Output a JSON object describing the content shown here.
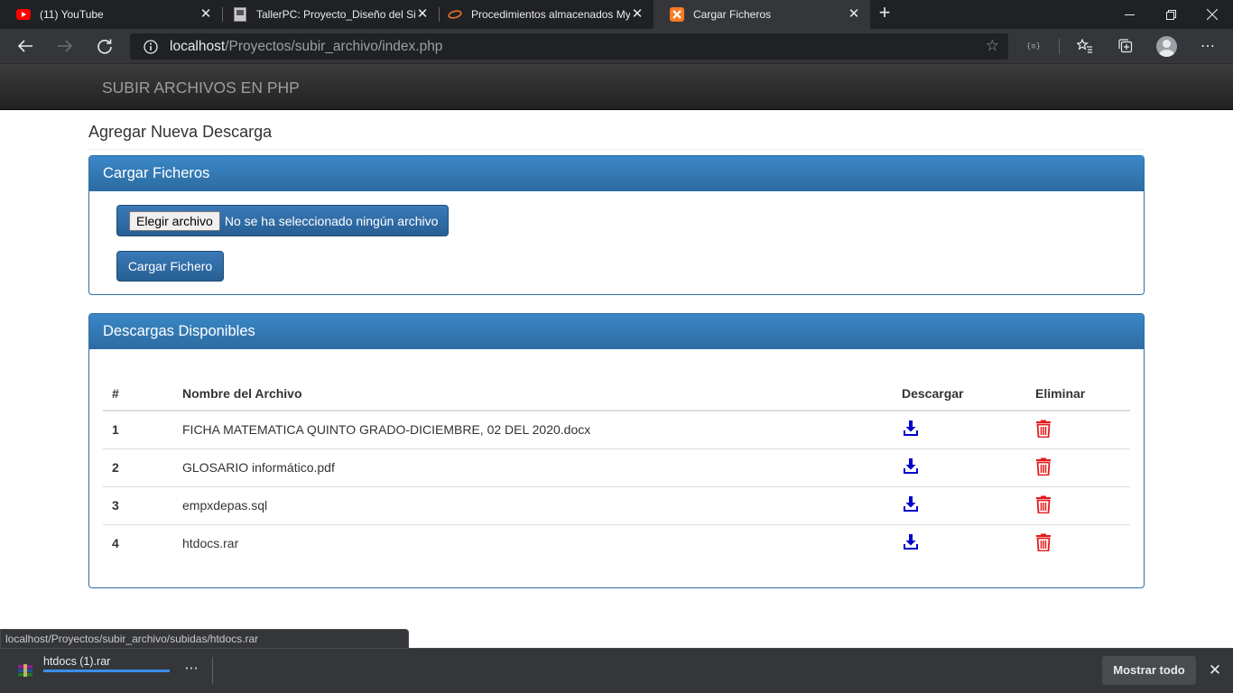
{
  "browser": {
    "tabs": [
      {
        "title": "(11) YouTube",
        "icon": "youtube-icon"
      },
      {
        "title": "TallerPC: Proyecto_Diseño del Sis",
        "icon": "page-icon"
      },
      {
        "title": "Procedimientos almacenados My",
        "icon": "link-icon"
      },
      {
        "title": "Cargar Ficheros",
        "icon": "xampp-icon"
      }
    ],
    "new_tab": "+",
    "url_host": "localhost",
    "url_path": "/Proyectos/subir_archivo/index.php",
    "close_glyph": "✕",
    "more_glyph": "⋯"
  },
  "navbar": {
    "brand": "SUBIR ARCHIVOS EN PHP"
  },
  "page": {
    "title": "Agregar Nueva Descarga"
  },
  "upload_panel": {
    "heading": "Cargar Ficheros",
    "choose_button": "Elegir archivo",
    "no_file_text": "No se ha seleccionado ningún archivo",
    "submit_button": "Cargar Fichero"
  },
  "downloads_panel": {
    "heading": "Descargas Disponibles",
    "columns": [
      "#",
      "Nombre del Archivo",
      "Descargar",
      "Eliminar"
    ],
    "rows": [
      {
        "num": "1",
        "name": "FICHA MATEMATICA QUINTO GRADO-DICIEMBRE, 02 DEL 2020.docx"
      },
      {
        "num": "2",
        "name": "GLOSARIO informático.pdf"
      },
      {
        "num": "3",
        "name": "empxdepas.sql"
      },
      {
        "num": "4",
        "name": "htdocs.rar"
      }
    ]
  },
  "status_bar": {
    "url": "localhost/Proyectos/subir_archivo/subidas/htdocs.rar"
  },
  "download_shelf": {
    "file_name": "htdocs (1).rar",
    "progress_percent": 100,
    "show_all": "Mostrar todo"
  },
  "colors": {
    "download_icon": "#0000cc",
    "delete_icon": "#e31b1b",
    "panel_primary": "#337ab7"
  }
}
